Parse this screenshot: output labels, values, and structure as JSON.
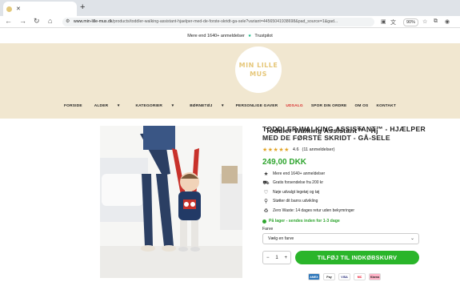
{
  "browser": {
    "tab_title": "Toddler Walking Assistant™ - Hj",
    "url_host": "www.min-lille-mus.dk",
    "url_path": "/products/toddler-walking-assistant-hjaelper-med-de-forste-skridt-ga-sele?variant=44565041938698&pad_source=1&gad...",
    "zoom": "90%"
  },
  "announcement": {
    "text": "Mere end 1640+ anmeldelser",
    "trustpilot": "Trustpilot"
  },
  "logo": {
    "line1": "MIN LILLE",
    "line2": "MUS"
  },
  "nav": [
    "FORSIDE",
    "ALDER",
    "KATEGORIER",
    "BØRNETØJ",
    "PERSONLIGE GAVER",
    "UDSALG",
    "SPOR DIN ORDRE",
    "OM OS",
    "KONTAKT"
  ],
  "product": {
    "title": "TODDLER WALKING ASSISTANT™ - HJÆLPER MED DE FØRSTE SKRIDT - GÅ-SELE",
    "rating": "4.6",
    "reviews": "(11 anmeldelser)",
    "price": "249,00 DKK",
    "features": [
      {
        "icon": "star-icon",
        "text": "Mere end 1640+ anmeldelser"
      },
      {
        "icon": "truck-icon",
        "text": "Gratis forsendelse fra 200 kr"
      },
      {
        "icon": "heart-icon",
        "text": "Nøje udvalgt legetøj og tøj"
      },
      {
        "icon": "growth-icon",
        "text": "Støtter dit barns udvikling"
      },
      {
        "icon": "return-icon",
        "text": "Zero Waste: 14 dages retur uden bekymringer"
      }
    ],
    "stock": "På lager - sendes inden for 1-3 dage",
    "color_label": "Farve",
    "color_select": "Vælg en farve",
    "qty": "1",
    "cart_button": "TILFØJ TIL INDKØBSKURV"
  },
  "payments": [
    "AMEX",
    "Pay",
    "VISA",
    "MC",
    "Klarna"
  ],
  "colors": {
    "header_bg": "#f1e7d0",
    "accent_green": "#2ab52a",
    "sale_red": "#d82c2c",
    "stars": "#e1a325"
  }
}
